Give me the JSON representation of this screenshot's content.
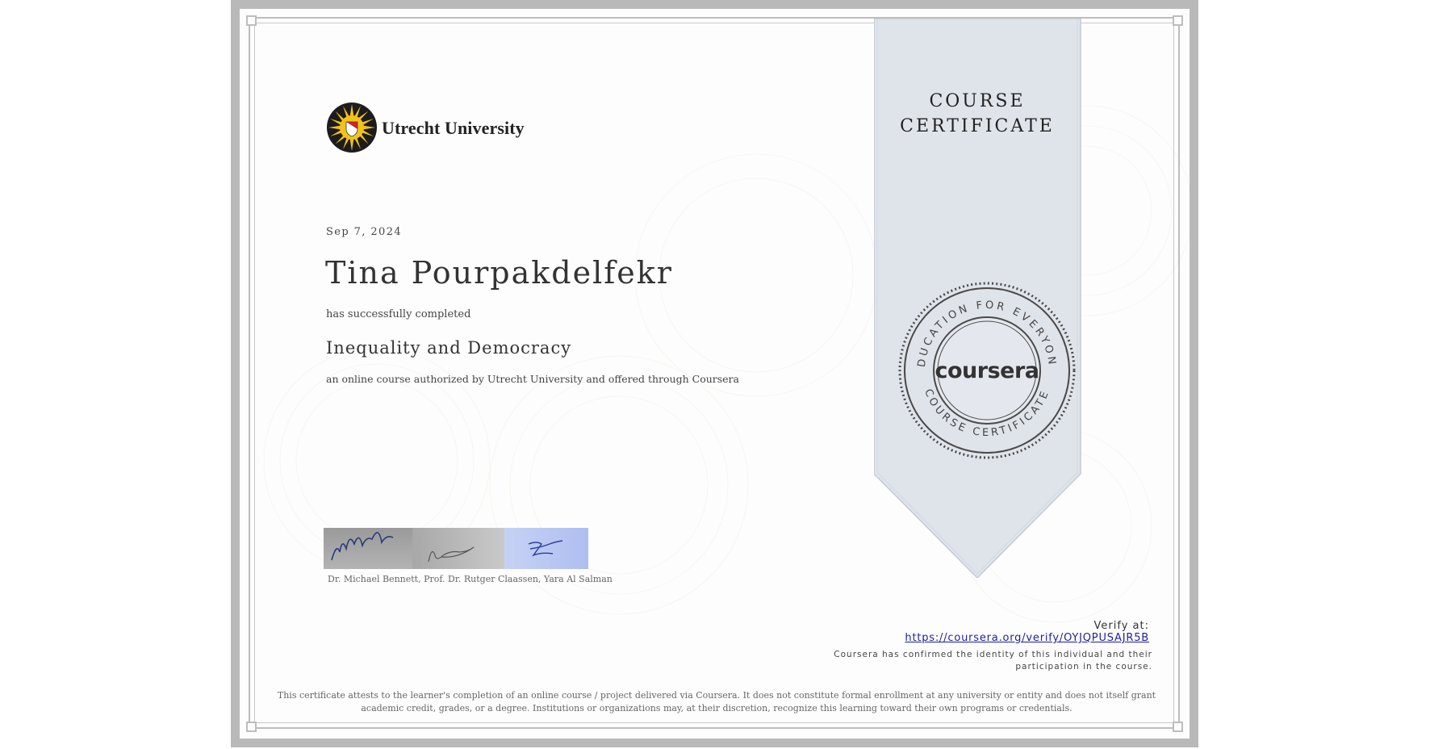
{
  "institution": {
    "name": "Utrecht University",
    "logo_icon": "utrecht-sun-seal"
  },
  "certificate": {
    "date": "Sep 7, 2024",
    "recipient_name": "Tina Pourpakdelfekr",
    "completed_text": "has successfully completed",
    "course_title": "Inequality and Democracy",
    "offered_text": "an online course authorized by Utrecht University and offered through Coursera",
    "signatories": "Dr. Michael Bennett, Prof. Dr. Rutger Claassen, Yara Al Salman",
    "ribbon_title_line1": "COURSE",
    "ribbon_title_line2": "CERTIFICATE"
  },
  "seal": {
    "top_text": "EDUCATION FOR EVERYONE",
    "bottom_text": "COURSE CERTIFICATE",
    "brand": "coursera"
  },
  "verification": {
    "label": "Verify at:",
    "url": "https://coursera.org/verify/OYJQPUSAJR5B",
    "confirm_text": "Coursera has confirmed the identity of this individual and their participation in the course."
  },
  "disclaimer": "This certificate attests to the learner's completion of an online course / project delivered via Coursera. It does not constitute formal enrollment at any university or entity and does not itself grant academic credit, grades, or a degree. Institutions or organizations may, at their discretion, recognize this learning toward their own programs or credentials.",
  "colors": {
    "ribbon": "#dfe4eb",
    "link": "#1f1f9c",
    "seal": "#444444",
    "logo_yellow": "#f2c21b",
    "logo_red": "#c0282d"
  }
}
